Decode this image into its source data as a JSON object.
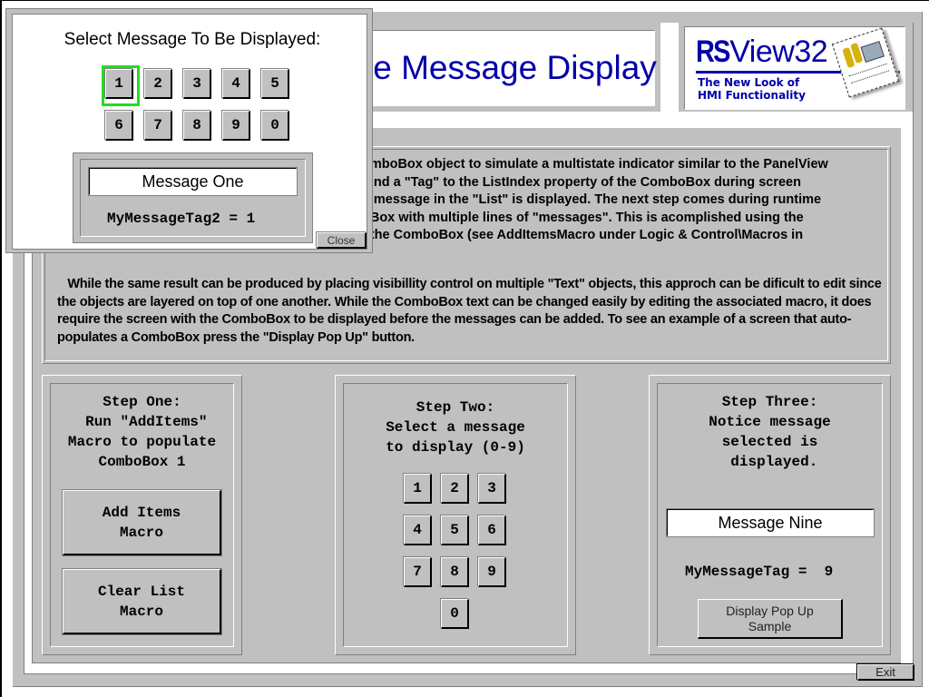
{
  "header": {
    "title": "Multiple Message Display",
    "title_visible": "le Message Display"
  },
  "logo": {
    "brand_bold": "RS",
    "brand_rest": "View32",
    "tagline_line1": "The New Look of",
    "tagline_line2": "HMI Functionality",
    "icon": "rsview-box-graphic"
  },
  "description": {
    "paragraph1_lines": [
      "omboBox object to simulate a multistate indicator similar to the PanelView",
      "bind a \"Tag\" to the ListIndex property of the ComboBox during screen",
      "n message in the \"List\" is displayed. The next step comes during runtime",
      "oBox with multiple lines of \"messages\". This is acomplished using the",
      "f the ComboBox (see AddItemsMacro under Logic & Control\\Macros in"
    ],
    "paragraph2": "   While the same result can be produced by placing visibillity control on multiple \"Text\" objects, this approch can be dificult to edit since the objects are layered on top of one another. While the ComboBox text can be changed easily by editing the associated macro, it does require the screen with the ComboBox to be displayed before the messages can be added. To see an example of a screen that auto-populates a ComboBox press the \"Display Pop Up\" button."
  },
  "step1": {
    "text": "Step One:\n Run \"AddItems\"\nMacro to populate\nComboBox 1",
    "add_items_button": "Add Items\nMacro",
    "clear_list_button": "Clear List\nMacro"
  },
  "step2": {
    "text": "Step Two:\nSelect a message\nto display (0-9)",
    "keys": [
      "1",
      "2",
      "3",
      "4",
      "5",
      "6",
      "7",
      "8",
      "9",
      "0"
    ]
  },
  "step3": {
    "text": "Step Three:\nNotice message\nselected is\n displayed.",
    "message_display": "Message Nine",
    "tag_label": "MyMessageTag =  9",
    "tag_name": "MyMessageTag",
    "tag_value": 9,
    "popup_button": "Display Pop Up\nSample"
  },
  "popup": {
    "title": "Select Message To Be Displayed:",
    "keys": [
      "1",
      "2",
      "3",
      "4",
      "5",
      "6",
      "7",
      "8",
      "9",
      "0"
    ],
    "selected_key": "1",
    "highlight_color": "#22dd22",
    "message_display": "Message One",
    "tag_label": "MyMessageTag2 = 1",
    "tag_name": "MyMessageTag2",
    "tag_value": 1,
    "close_button": "Close"
  },
  "footer": {
    "exit_button": "Exit"
  },
  "colors": {
    "panel_gray": "#c0c0c0",
    "title_blue": "#0000a8",
    "shadow": "#808080"
  }
}
